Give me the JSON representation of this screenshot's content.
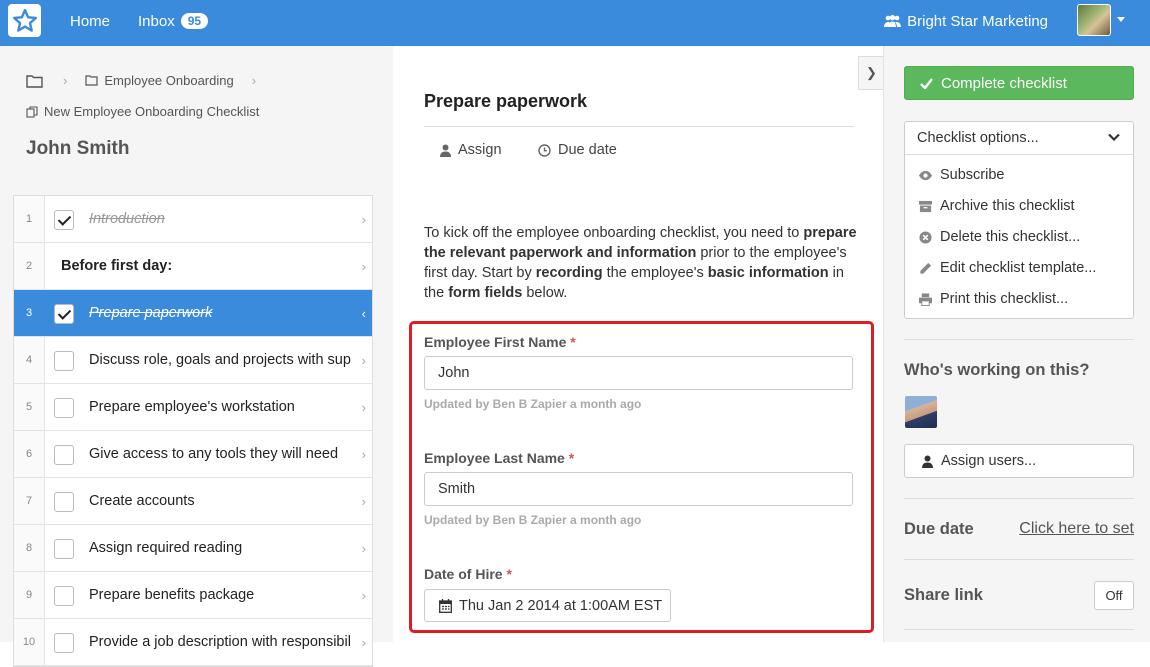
{
  "topbar": {
    "home_label": "Home",
    "inbox_label": "Inbox",
    "inbox_count": "95",
    "org_name": "Bright Star Marketing",
    "accent_color": "#3a8bdc"
  },
  "breadcrumb": {
    "folder_label": "Employee Onboarding",
    "template_label": "New Employee Onboarding Checklist"
  },
  "checklist_name": "John Smith",
  "tasks": [
    {
      "num": "1",
      "label": "Introduction",
      "checked": true,
      "done": true
    },
    {
      "num": "2",
      "label": "Before first day:",
      "heading": true
    },
    {
      "num": "3",
      "label": "Prepare paperwork",
      "checked": true,
      "done": true,
      "active": true
    },
    {
      "num": "4",
      "label": "Discuss role, goals and projects with sup"
    },
    {
      "num": "5",
      "label": "Prepare employee's workstation"
    },
    {
      "num": "6",
      "label": "Give access to any tools they will need"
    },
    {
      "num": "7",
      "label": "Create accounts"
    },
    {
      "num": "8",
      "label": "Assign required reading"
    },
    {
      "num": "9",
      "label": "Prepare benefits package"
    },
    {
      "num": "10",
      "label": "Provide a job description with responsibil"
    }
  ],
  "task_detail": {
    "title": "Prepare paperwork",
    "assign_label": "Assign",
    "due_label": "Due date",
    "desc": {
      "p1": "To kick off the employee onboarding checklist, you need to ",
      "b1": "prepare the relevant paperwork and information",
      "p2": " prior to the employee's first day. Start by ",
      "b2": "recording",
      "p3": " the employee's ",
      "b3": "basic information",
      "p4": " in the ",
      "b4": "form fields",
      "p5": " below."
    },
    "fields": {
      "first_name": {
        "label": "Employee First Name",
        "required": "*",
        "value": "John",
        "meta": "Updated by Ben B Zapier a month ago"
      },
      "last_name": {
        "label": "Employee Last Name",
        "required": "*",
        "value": "Smith",
        "meta": "Updated by Ben B Zapier a month ago"
      },
      "hire_date": {
        "label": "Date of Hire",
        "required": "*",
        "value": "Thu Jan 2 2014 at 1:00AM EST"
      }
    },
    "highlight_color": "#e01b24"
  },
  "sidebar": {
    "complete_label": "Complete checklist",
    "complete_color": "#5cb85c",
    "options_label": "Checklist options...",
    "options": {
      "subscribe": "Subscribe",
      "archive": "Archive this checklist",
      "delete": "Delete this checklist...",
      "edit": "Edit checklist template...",
      "print": "Print this checklist..."
    },
    "working_title": "Who's working on this?",
    "assign_users_label": "Assign users...",
    "due_title": "Due date",
    "due_link": "Click here to set",
    "share_title": "Share link",
    "share_toggle": "Off"
  }
}
